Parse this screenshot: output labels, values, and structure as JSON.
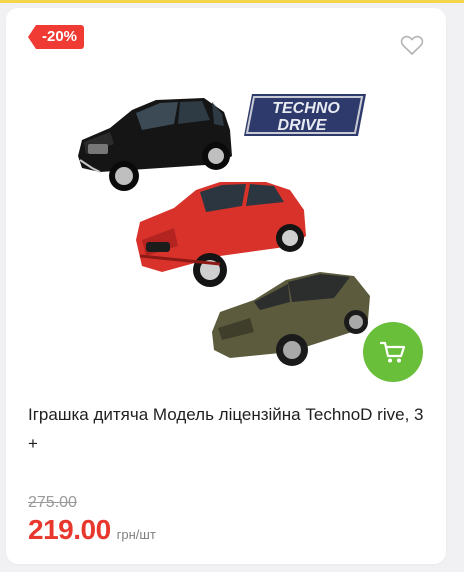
{
  "badge": {
    "discount": "-20%"
  },
  "product": {
    "title": "Іграшка дитяча Модель ліцензійна TechnoD rive, 3+",
    "brand_logo_line1": "TECHNO",
    "brand_logo_line2": "DRIVE",
    "image_alt": "Три машинки: чорний позашляховик, червоний кросовер, оливкове купе"
  },
  "pricing": {
    "old_price": "275.00",
    "new_price": "219.00",
    "unit": "грн/шт"
  },
  "icons": {
    "favorite": "heart-outline-icon",
    "cart": "cart-icon"
  },
  "colors": {
    "badge_red": "#ef3b33",
    "price_red": "#e8382d",
    "cart_green": "#6abf3a",
    "top_strip_yellow": "#f5d64a"
  }
}
